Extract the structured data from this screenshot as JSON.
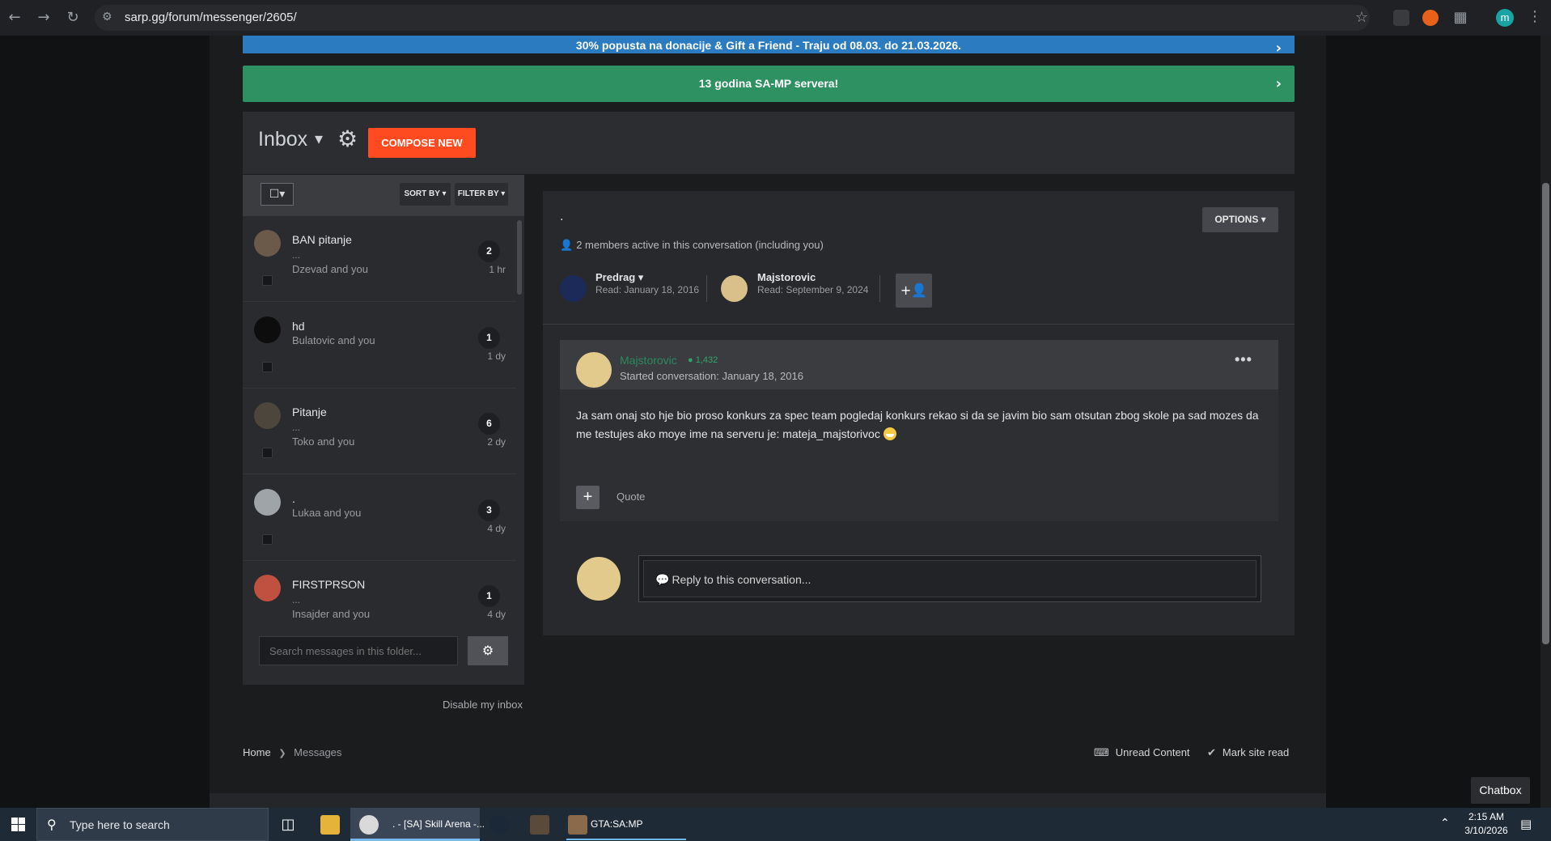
{
  "browser": {
    "url": "sarp.gg/forum/messenger/2605/",
    "profile_initial": "m"
  },
  "banners": {
    "blue_text": "30% popusta na donacije & Gift a Friend - Traju od 08.03. do 21.03.2026.",
    "green_text": "13 godina SA-MP servera!"
  },
  "inbox": {
    "title": "Inbox",
    "compose_label": "COMPOSE NEW",
    "sort_label": "SORT BY ▾",
    "filter_label": "FILTER BY ▾",
    "conversations": [
      {
        "title": "BAN pitanje",
        "preview": "...",
        "participants": "Dzevad and you",
        "count": "2",
        "time": "1 hr"
      },
      {
        "title": "hd",
        "preview": "",
        "participants": "Bulatovic and you",
        "count": "1",
        "time": "1 dy"
      },
      {
        "title": "Pitanje",
        "preview": "...",
        "participants": "Toko and you",
        "count": "6",
        "time": "2 dy"
      },
      {
        "title": ".",
        "preview": "",
        "participants": "Lukaa and you",
        "count": "3",
        "time": "4 dy"
      },
      {
        "title": "FIRSTPRSON",
        "preview": "...",
        "participants": "Insajder and you",
        "count": "1",
        "time": "4 dy"
      }
    ],
    "search_placeholder": "Search messages in this folder...",
    "disable_label": "Disable my inbox"
  },
  "conversation": {
    "title": ".",
    "options_label": "OPTIONS ▾",
    "members_active": "2 members active in this conversation (including you)",
    "members": [
      {
        "name": "Predrag ▾",
        "read": "Read: January 18, 2016"
      },
      {
        "name": "Majstorovic",
        "read": "Read: September 9, 2024"
      }
    ],
    "post": {
      "author": "Majstorovic",
      "reputation": "● 1,432",
      "started": "Started conversation: January 18, 2016",
      "body": "Ja sam onaj sto hje bio proso konkurs za spec team pogledaj konkurs rekao si da se javim bio sam otsutan zbog skole pa sad mozes da me testujes ako moye ime na serveru je: mateja_majstorivoc",
      "quote_label": "Quote"
    },
    "reply_placeholder": "Reply to this conversation..."
  },
  "footer": {
    "breadcrumb_home": "Home",
    "breadcrumb_messages": "Messages",
    "unread_content": "Unread Content",
    "mark_site_read": "Mark site read",
    "chatbox": "Chatbox"
  },
  "taskbar": {
    "search_placeholder": "Type here to search",
    "chrome_label": ". - [SA] Skill Arena -...",
    "gta_label": "GTA:SA:MP",
    "time": "2:15 AM",
    "date": "3/10/2026"
  },
  "icons": [
    "back-icon",
    "forward-icon",
    "reload-icon",
    "site-settings-icon",
    "star-icon",
    "extension-icon",
    "gear-icon",
    "chevron-right-icon",
    "user-icon",
    "add-user-icon",
    "comment-icon",
    "keyboard-icon",
    "check-icon",
    "windows-icon",
    "search-icon"
  ],
  "colors": {
    "accent_orange": "#ff4b1f",
    "banner_green": "#2e9162",
    "banner_blue": "#2b7bc0",
    "author_green": "#2a8a5e"
  }
}
